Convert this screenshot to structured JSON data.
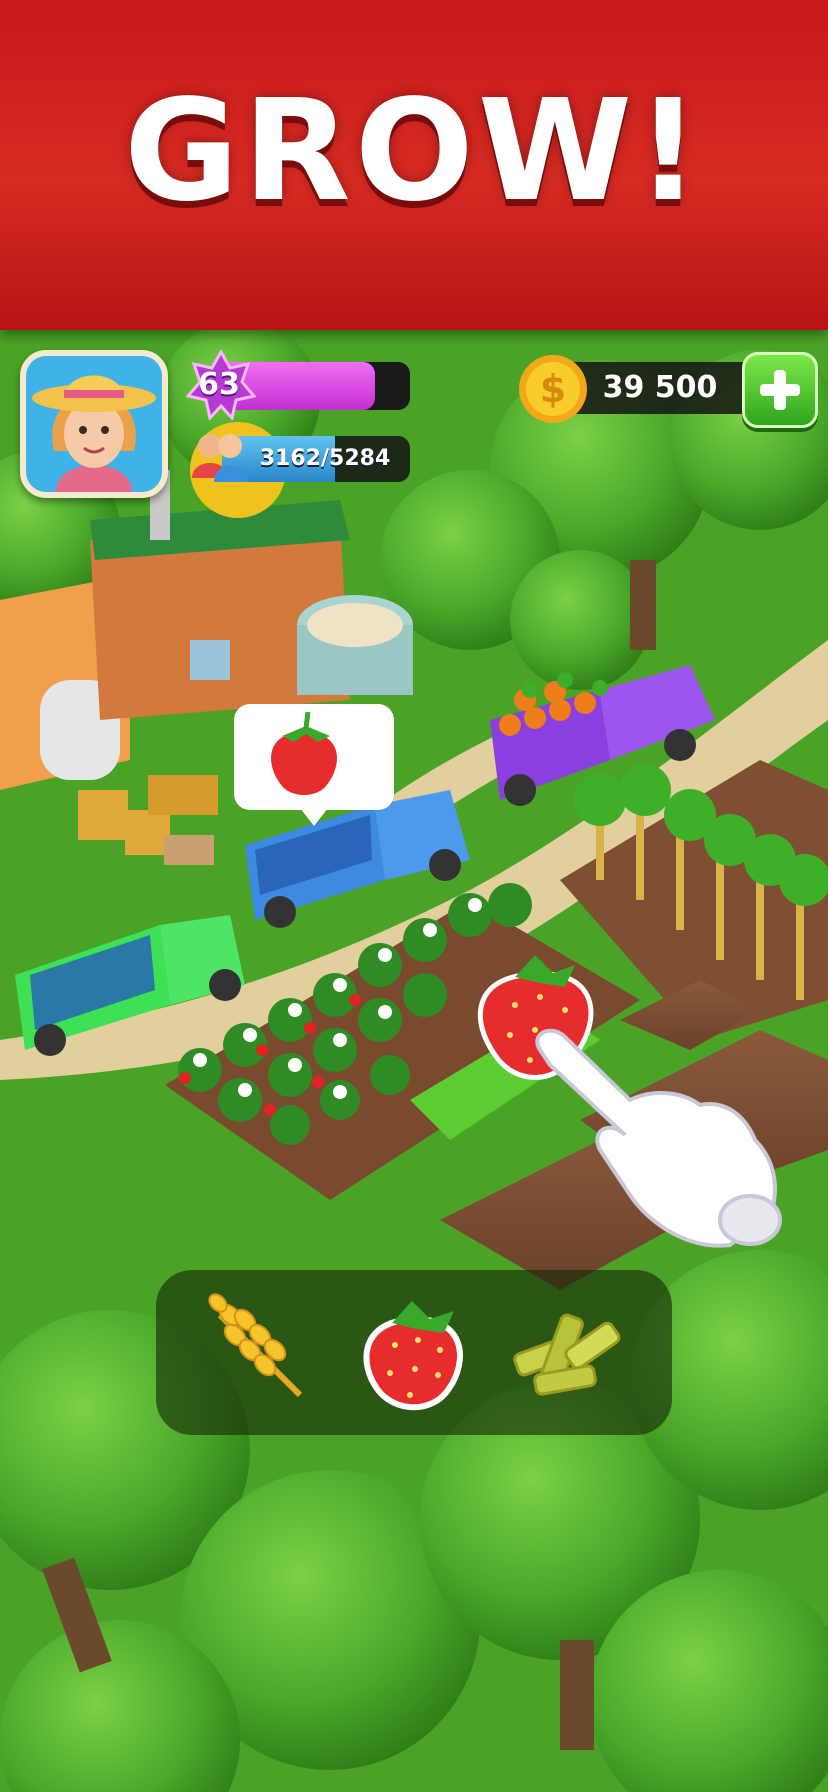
{
  "banner": {
    "title": "GROW!"
  },
  "hud": {
    "level": "63",
    "level_progress": 0.82,
    "population_text": "3162/5284",
    "population_progress": 0.6,
    "coins": "39 500"
  },
  "crop_selector": {
    "items": [
      "wheat-icon",
      "strawberry-icon",
      "sugarcane-icon"
    ],
    "selected": "strawberry-icon"
  },
  "colors": {
    "banner_red": "#d0201e",
    "level_magenta": "#e05ae8",
    "population_blue": "#3aa0dc",
    "coin_gold": "#f6c21a",
    "plus_green": "#4cc62c"
  }
}
